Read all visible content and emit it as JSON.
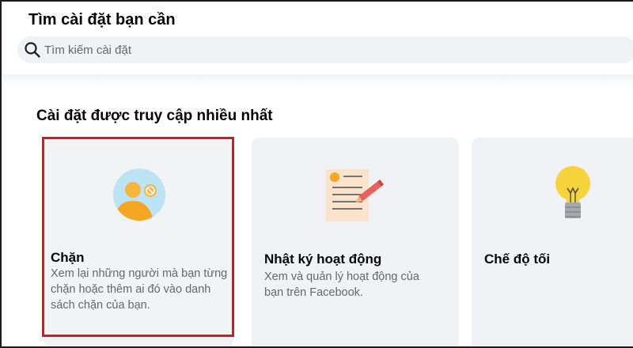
{
  "header": {
    "title": "Tìm cài đặt bạn cần",
    "search_placeholder": "Tìm kiếm cài đặt"
  },
  "section": {
    "title": "Cài đặt được truy cập nhiều nhất"
  },
  "cards": [
    {
      "title": "Chặn",
      "description": "Xem lại những người mà bạn từng chặn hoặc thêm ai đó vào danh sách chặn của bạn.",
      "icon": "block-user-icon",
      "highlighted": true
    },
    {
      "title": "Nhật ký hoạt động",
      "description": "Xem và quản lý hoạt động của bạn trên Facebook.",
      "icon": "activity-log-icon"
    },
    {
      "title": "Chế độ tối",
      "description": "",
      "icon": "lightbulb-icon"
    }
  ],
  "colors": {
    "highlight": "#e0141e",
    "card_bg": "#f0f2f5",
    "accent_orange": "#f7b928",
    "accent_blue": "#bde3f7"
  }
}
